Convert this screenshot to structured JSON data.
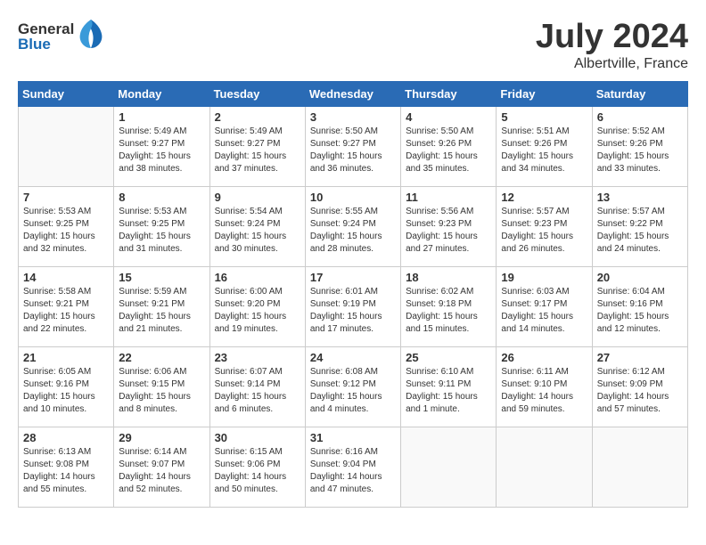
{
  "header": {
    "logo_general": "General",
    "logo_blue": "Blue",
    "title": "July 2024",
    "subtitle": "Albertville, France"
  },
  "calendar": {
    "days_of_week": [
      "Sunday",
      "Monday",
      "Tuesday",
      "Wednesday",
      "Thursday",
      "Friday",
      "Saturday"
    ],
    "weeks": [
      [
        {
          "day": "",
          "empty": true
        },
        {
          "day": "1",
          "sunrise": "Sunrise: 5:49 AM",
          "sunset": "Sunset: 9:27 PM",
          "daylight": "Daylight: 15 hours and 38 minutes."
        },
        {
          "day": "2",
          "sunrise": "Sunrise: 5:49 AM",
          "sunset": "Sunset: 9:27 PM",
          "daylight": "Daylight: 15 hours and 37 minutes."
        },
        {
          "day": "3",
          "sunrise": "Sunrise: 5:50 AM",
          "sunset": "Sunset: 9:27 PM",
          "daylight": "Daylight: 15 hours and 36 minutes."
        },
        {
          "day": "4",
          "sunrise": "Sunrise: 5:50 AM",
          "sunset": "Sunset: 9:26 PM",
          "daylight": "Daylight: 15 hours and 35 minutes."
        },
        {
          "day": "5",
          "sunrise": "Sunrise: 5:51 AM",
          "sunset": "Sunset: 9:26 PM",
          "daylight": "Daylight: 15 hours and 34 minutes."
        },
        {
          "day": "6",
          "sunrise": "Sunrise: 5:52 AM",
          "sunset": "Sunset: 9:26 PM",
          "daylight": "Daylight: 15 hours and 33 minutes."
        }
      ],
      [
        {
          "day": "7",
          "sunrise": "Sunrise: 5:53 AM",
          "sunset": "Sunset: 9:25 PM",
          "daylight": "Daylight: 15 hours and 32 minutes."
        },
        {
          "day": "8",
          "sunrise": "Sunrise: 5:53 AM",
          "sunset": "Sunset: 9:25 PM",
          "daylight": "Daylight: 15 hours and 31 minutes."
        },
        {
          "day": "9",
          "sunrise": "Sunrise: 5:54 AM",
          "sunset": "Sunset: 9:24 PM",
          "daylight": "Daylight: 15 hours and 30 minutes."
        },
        {
          "day": "10",
          "sunrise": "Sunrise: 5:55 AM",
          "sunset": "Sunset: 9:24 PM",
          "daylight": "Daylight: 15 hours and 28 minutes."
        },
        {
          "day": "11",
          "sunrise": "Sunrise: 5:56 AM",
          "sunset": "Sunset: 9:23 PM",
          "daylight": "Daylight: 15 hours and 27 minutes."
        },
        {
          "day": "12",
          "sunrise": "Sunrise: 5:57 AM",
          "sunset": "Sunset: 9:23 PM",
          "daylight": "Daylight: 15 hours and 26 minutes."
        },
        {
          "day": "13",
          "sunrise": "Sunrise: 5:57 AM",
          "sunset": "Sunset: 9:22 PM",
          "daylight": "Daylight: 15 hours and 24 minutes."
        }
      ],
      [
        {
          "day": "14",
          "sunrise": "Sunrise: 5:58 AM",
          "sunset": "Sunset: 9:21 PM",
          "daylight": "Daylight: 15 hours and 22 minutes."
        },
        {
          "day": "15",
          "sunrise": "Sunrise: 5:59 AM",
          "sunset": "Sunset: 9:21 PM",
          "daylight": "Daylight: 15 hours and 21 minutes."
        },
        {
          "day": "16",
          "sunrise": "Sunrise: 6:00 AM",
          "sunset": "Sunset: 9:20 PM",
          "daylight": "Daylight: 15 hours and 19 minutes."
        },
        {
          "day": "17",
          "sunrise": "Sunrise: 6:01 AM",
          "sunset": "Sunset: 9:19 PM",
          "daylight": "Daylight: 15 hours and 17 minutes."
        },
        {
          "day": "18",
          "sunrise": "Sunrise: 6:02 AM",
          "sunset": "Sunset: 9:18 PM",
          "daylight": "Daylight: 15 hours and 15 minutes."
        },
        {
          "day": "19",
          "sunrise": "Sunrise: 6:03 AM",
          "sunset": "Sunset: 9:17 PM",
          "daylight": "Daylight: 15 hours and 14 minutes."
        },
        {
          "day": "20",
          "sunrise": "Sunrise: 6:04 AM",
          "sunset": "Sunset: 9:16 PM",
          "daylight": "Daylight: 15 hours and 12 minutes."
        }
      ],
      [
        {
          "day": "21",
          "sunrise": "Sunrise: 6:05 AM",
          "sunset": "Sunset: 9:16 PM",
          "daylight": "Daylight: 15 hours and 10 minutes."
        },
        {
          "day": "22",
          "sunrise": "Sunrise: 6:06 AM",
          "sunset": "Sunset: 9:15 PM",
          "daylight": "Daylight: 15 hours and 8 minutes."
        },
        {
          "day": "23",
          "sunrise": "Sunrise: 6:07 AM",
          "sunset": "Sunset: 9:14 PM",
          "daylight": "Daylight: 15 hours and 6 minutes."
        },
        {
          "day": "24",
          "sunrise": "Sunrise: 6:08 AM",
          "sunset": "Sunset: 9:12 PM",
          "daylight": "Daylight: 15 hours and 4 minutes."
        },
        {
          "day": "25",
          "sunrise": "Sunrise: 6:10 AM",
          "sunset": "Sunset: 9:11 PM",
          "daylight": "Daylight: 15 hours and 1 minute."
        },
        {
          "day": "26",
          "sunrise": "Sunrise: 6:11 AM",
          "sunset": "Sunset: 9:10 PM",
          "daylight": "Daylight: 14 hours and 59 minutes."
        },
        {
          "day": "27",
          "sunrise": "Sunrise: 6:12 AM",
          "sunset": "Sunset: 9:09 PM",
          "daylight": "Daylight: 14 hours and 57 minutes."
        }
      ],
      [
        {
          "day": "28",
          "sunrise": "Sunrise: 6:13 AM",
          "sunset": "Sunset: 9:08 PM",
          "daylight": "Daylight: 14 hours and 55 minutes."
        },
        {
          "day": "29",
          "sunrise": "Sunrise: 6:14 AM",
          "sunset": "Sunset: 9:07 PM",
          "daylight": "Daylight: 14 hours and 52 minutes."
        },
        {
          "day": "30",
          "sunrise": "Sunrise: 6:15 AM",
          "sunset": "Sunset: 9:06 PM",
          "daylight": "Daylight: 14 hours and 50 minutes."
        },
        {
          "day": "31",
          "sunrise": "Sunrise: 6:16 AM",
          "sunset": "Sunset: 9:04 PM",
          "daylight": "Daylight: 14 hours and 47 minutes."
        },
        {
          "day": "",
          "empty": true
        },
        {
          "day": "",
          "empty": true
        },
        {
          "day": "",
          "empty": true
        }
      ]
    ]
  }
}
